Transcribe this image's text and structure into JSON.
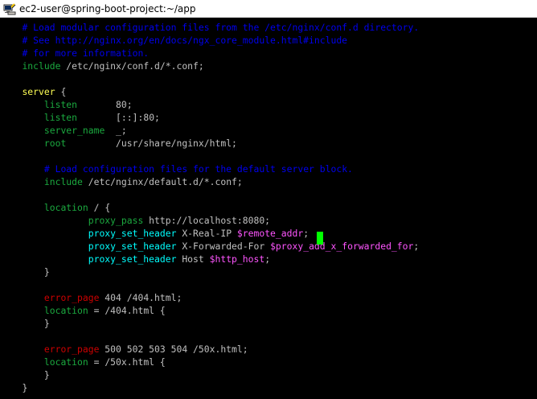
{
  "window": {
    "title": "ec2-user@spring-boot-project:~/app",
    "icon": "putty-terminal-icon"
  },
  "colors": {
    "background": "#000000",
    "comment": "#0000ee",
    "keyword": "#ffff55",
    "text": "#c0c0c0",
    "directive": "#1ba93f",
    "proxy": "#00ffff",
    "variable": "#ff55ff",
    "error": "#cd0000",
    "cursor": "#00ff00"
  },
  "terminal": {
    "header": {
      "comment_1": "# Load modular configuration files from the /etc/nginx/conf.d directory.",
      "comment_2": "# See http://nginx.org/en/docs/ngx_core_module.html#include",
      "comment_3": "# for more information.",
      "include_keyword": "include",
      "include_path": " /etc/nginx/conf.d/*.conf;"
    },
    "server": {
      "keyword": "server",
      "open": " {",
      "listen_1_keyword": "listen",
      "listen_1_value": "80;",
      "listen_2_keyword": "listen",
      "listen_2_value": "[::]:80;",
      "server_name_keyword": "server_name",
      "server_name_value": "_;",
      "root_keyword": "root",
      "root_value": "/usr/share/nginx/html;",
      "default_comment": "# Load configuration files for the default server block.",
      "default_include_keyword": "include",
      "default_include_path": " /etc/nginx/default.d/*.conf;",
      "close": "}"
    },
    "location_root": {
      "keyword": "location",
      "rest": " / {",
      "proxy_pass_keyword": "proxy_pass",
      "proxy_pass_value": " http://localhost:8080;",
      "real_ip_keyword": "proxy_set_header",
      "real_ip_name": " X-Real-IP ",
      "real_ip_variable": "$remote_addr",
      "real_ip_end": ";",
      "forwarded_keyword": "proxy_set_header",
      "forwarded_name": " X-Forwarded-For ",
      "forwarded_variable": "$proxy_add_x_forwarded_for",
      "forwarded_end": ";",
      "host_keyword": "proxy_set_header",
      "host_name": " Host ",
      "host_variable": "$http_host",
      "host_end": ";",
      "close": "}"
    },
    "error_404": {
      "error_page_keyword": "error_page",
      "error_page_value": " 404 /404.html;",
      "location_keyword": "location",
      "location_value": " = /404.html {",
      "close": "}"
    },
    "error_50x": {
      "error_page_keyword": "error_page",
      "error_page_value": " 500 502 503 504 /50x.html;",
      "location_keyword": "location",
      "location_value": " = /50x.html {",
      "close": "}"
    },
    "closing_brace": "}"
  }
}
